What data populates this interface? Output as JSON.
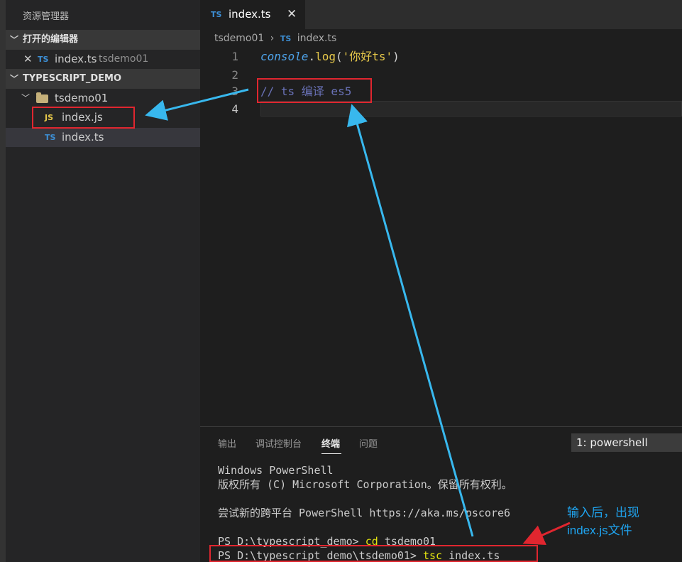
{
  "sidebar": {
    "title": "资源管理器",
    "open_editors": {
      "label": "打开的编辑器",
      "items": [
        {
          "close": "✕",
          "badge": "TS",
          "name": "index.ts",
          "folder": "tsdemo01"
        }
      ]
    },
    "workspace": {
      "label": "TYPESCRIPT_DEMO",
      "folder": "tsdemo01",
      "files": [
        {
          "badge": "JS",
          "name": "index.js"
        },
        {
          "badge": "TS",
          "name": "index.ts"
        }
      ]
    }
  },
  "editor": {
    "tab": {
      "badge": "TS",
      "label": "index.ts",
      "close": "✕"
    },
    "breadcrumb": {
      "folder": "tsdemo01",
      "separator": "›",
      "badge": "TS",
      "file": "index.ts"
    },
    "lines": [
      {
        "num": "1"
      },
      {
        "num": "2"
      },
      {
        "num": "3"
      },
      {
        "num": "4"
      }
    ],
    "code": {
      "line1": {
        "object": "console",
        "dot": ".",
        "method": "log",
        "open": "(",
        "string": "'你好ts'",
        "close": ")"
      },
      "line3": {
        "comment": "// ts 编译 es5"
      }
    }
  },
  "panel": {
    "tabs": [
      "输出",
      "调试控制台",
      "终端",
      "问题"
    ],
    "active_tab": "终端",
    "shell_select": "1: powershell",
    "terminal": {
      "line1": "Windows PowerShell",
      "line2": "版权所有 (C) Microsoft Corporation。保留所有权利。",
      "line3": "尝试新的跨平台 PowerShell https://aka.ms/pscore6",
      "line4_prompt": "PS D:\\typescript_demo> ",
      "line4_cmd": "cd",
      "line4_arg": " tsdemo01",
      "line5_prompt": "PS D:\\typescript_demo\\tsdemo01> ",
      "line5_cmd": "tsc",
      "line5_arg": " index.ts"
    }
  },
  "annotation": {
    "note_line1": "输入后，出现",
    "note_line2": "index.js文件",
    "arrow_color_blue": "#38b8ee",
    "arrow_color_red": "#e0262f"
  },
  "colors": {
    "ts_badge": "#3d8fd5",
    "js_badge": "#e6c84a",
    "comment": "#6a72b8",
    "string": "#e6c84a",
    "method": "#e6c84a",
    "object": "#4ea3ea",
    "terminal_cmd": "#e5e510"
  }
}
